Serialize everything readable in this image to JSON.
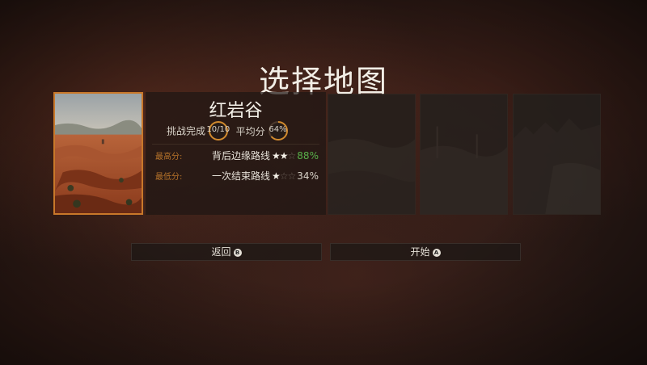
{
  "title": "选择地图",
  "selected_map": {
    "name": "红岩谷",
    "challenge_label": "挑战完成",
    "challenge_value": "10/10",
    "challenge_fraction": 1.0,
    "average_label": "平均分",
    "average_value": "64%",
    "average_fraction": 0.64,
    "routes": [
      {
        "label": "最高分:",
        "name": "背后边缘路线",
        "stars_filled": 2,
        "stars_total": 3,
        "percent": "88%"
      },
      {
        "label": "最低分:",
        "name": "一次结束路线",
        "stars_filled": 1,
        "stars_total": 3,
        "percent": "34%"
      }
    ]
  },
  "buttons": {
    "back": {
      "label": "返回",
      "icon": "B"
    },
    "start": {
      "label": "开始",
      "icon": "A"
    }
  },
  "colors": {
    "accent": "#c9782a",
    "good": "#58b04a"
  }
}
